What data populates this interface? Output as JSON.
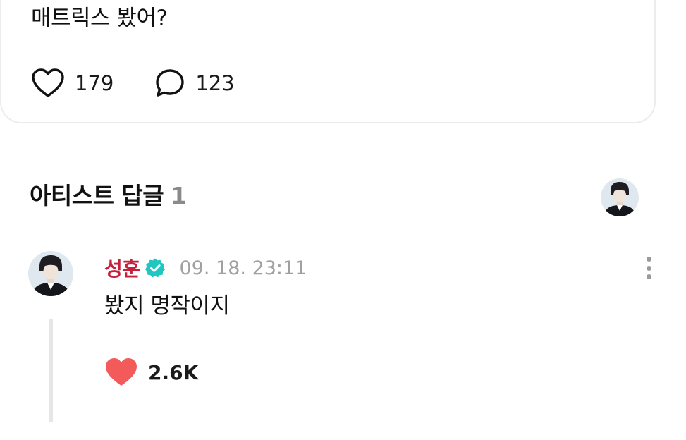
{
  "post": {
    "text": "매트릭스 봤어?",
    "like_count": "179",
    "comment_count": "123",
    "like_icon": "heart-outline-icon",
    "comment_icon": "speech-bubble-icon"
  },
  "artist_replies": {
    "title": "아티스트 답글",
    "count": "1"
  },
  "reply": {
    "author": "성훈",
    "verified_icon": "verified-badge-icon",
    "timestamp": "09. 18. 23:11",
    "text": "봤지 명작이지",
    "like_count": "2.6K",
    "like_icon": "heart-filled-icon",
    "more_icon": "more-vertical-icon"
  },
  "colors": {
    "author": "#c81f3c",
    "verified": "#1fc7c0",
    "liked_heart": "#f35b5b",
    "count_gray": "#8a8a8a"
  }
}
